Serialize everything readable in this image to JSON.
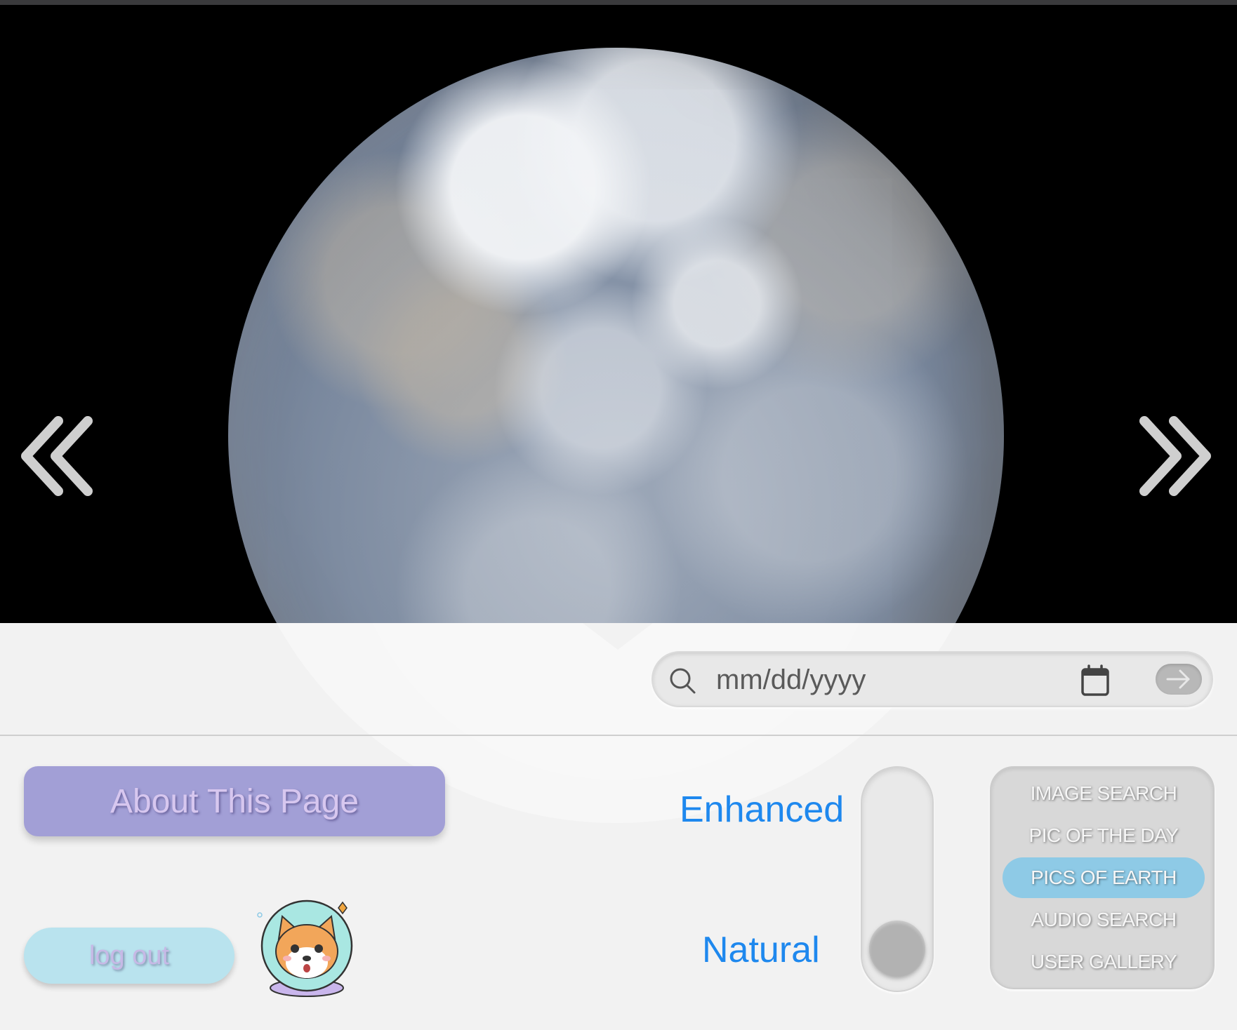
{
  "hero": {
    "image_description_icon": "earth-globe-image",
    "prev_icon": "double-chevron-left-icon",
    "next_icon": "double-chevron-right-icon"
  },
  "search": {
    "placeholder": "mm/dd/yyyy",
    "value": "",
    "search_icon": "search-icon",
    "calendar_icon": "calendar-icon",
    "go_icon": "arrow-right-icon"
  },
  "buttons": {
    "about": "About This Page",
    "logout": "log out"
  },
  "toggle": {
    "top_label": "Enhanced",
    "bottom_label": "Natural",
    "selected": "Natural"
  },
  "nav_menu": {
    "items": [
      {
        "label": "IMAGE SEARCH",
        "active": false
      },
      {
        "label": "PIC OF THE DAY",
        "active": false
      },
      {
        "label": "PICS OF EARTH",
        "active": true
      },
      {
        "label": "AUDIO SEARCH",
        "active": false
      },
      {
        "label": "USER GALLERY",
        "active": false
      }
    ]
  },
  "colors": {
    "accent_blue": "#1e88ee",
    "about_button": "#a29fd6",
    "logout_button": "#b9e3ee",
    "active_nav": "#8ecae6",
    "panel_bg": "#f2f2f2"
  }
}
